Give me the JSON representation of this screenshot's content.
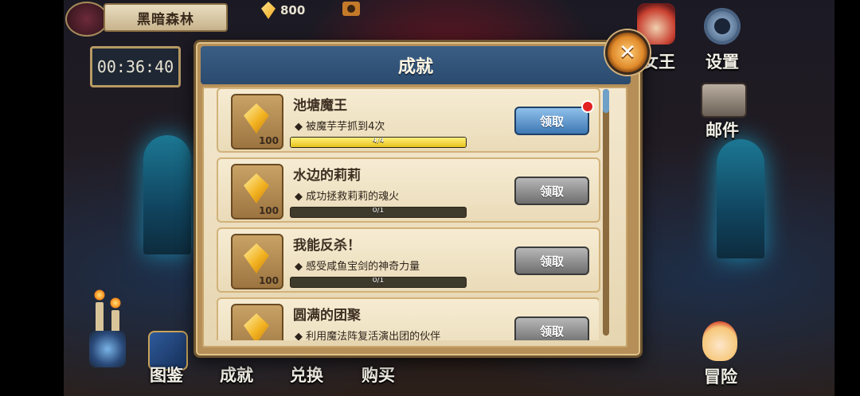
{
  "hud": {
    "map_name": "黑暗森林",
    "timer": "00:36:40",
    "gems": "800",
    "right_menu": {
      "king": "女王",
      "settings": "设置",
      "mail": "邮件",
      "adventure": "冒险"
    },
    "bottom_menu": {
      "codex": "图鉴",
      "achievement": "成就",
      "exchange": "兑换",
      "shop": "购买"
    }
  },
  "panel": {
    "title": "成就",
    "close_symbol": "✕",
    "items": [
      {
        "title": "池塘魔王",
        "desc": "◆ 被魔芋芋抓到4次",
        "reward": "100",
        "progress": "4/4",
        "progress_fraction": 1.0,
        "button": "领取",
        "claimable": true
      },
      {
        "title": "水边的莉莉",
        "desc": "◆ 成功拯救莉莉的魂火",
        "reward": "100",
        "progress": "0/1",
        "progress_fraction": 0,
        "button": "领取",
        "claimable": false
      },
      {
        "title": "我能反杀！",
        "desc": "◆ 感受咸鱼宝剑的神奇力量",
        "reward": "100",
        "progress": "0/1",
        "progress_fraction": 0,
        "button": "领取",
        "claimable": false
      },
      {
        "title": "圆满的团聚",
        "desc": "◆ 利用魔法阵复活演出团的伙伴",
        "button": "领取",
        "claimable": false
      }
    ]
  },
  "colors": {
    "panel_header": "#2b4a6e",
    "claim_active": "#3d78b3",
    "claim_disabled": "#6e6e6e",
    "progress_fill": "#e6c21c"
  }
}
